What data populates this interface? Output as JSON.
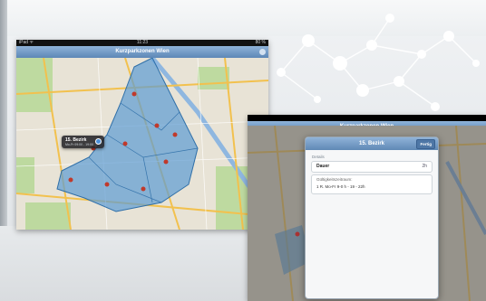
{
  "tablet1": {
    "status": {
      "carrier": "iPad ᯤ",
      "time": "11:23",
      "battery": "80 %"
    },
    "navbar_title": "Kurzparkzonen Wien",
    "callout": {
      "title": "15. Bezirk",
      "subtitle": "Mo-Fr 09:00 - 19:00"
    }
  },
  "tablet2": {
    "navbar_title": "Kurzparkzonen Wien",
    "popover": {
      "title": "15. Bezirk",
      "close_label": "Fertig",
      "section_label": "Details",
      "rows": [
        {
          "label": "Dauer",
          "value": "2h"
        },
        {
          "label": "Gültigkeitszeitraum:",
          "value": "1 R. Mo-Fr 9-0 h - 19 - 22h"
        }
      ]
    }
  },
  "colors": {
    "zone_fill": "#5c9bd3",
    "map_base": "#e8e3d6",
    "park": "#b9d89a",
    "road_major": "#f2c14e",
    "navbar": "#6f97c4"
  },
  "icons": [
    "gear-icon",
    "info-icon",
    "map-pin-icon"
  ]
}
